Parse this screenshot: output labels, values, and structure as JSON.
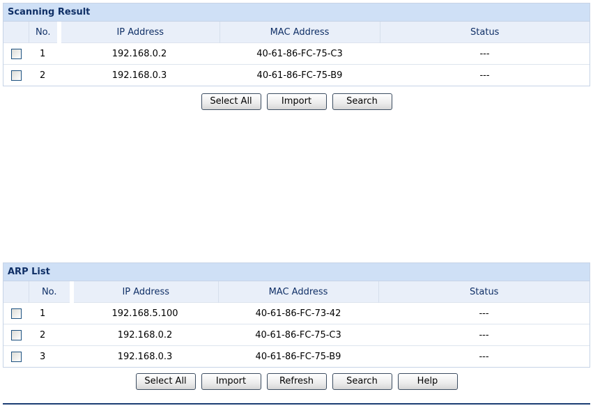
{
  "scanning_result": {
    "title": "Scanning Result",
    "columns": {
      "no": "No.",
      "ip": "IP Address",
      "mac": "MAC Address",
      "status": "Status"
    },
    "rows": [
      {
        "no": "1",
        "ip": "192.168.0.2",
        "mac": "40-61-86-FC-75-C3",
        "status": "---"
      },
      {
        "no": "2",
        "ip": "192.168.0.3",
        "mac": "40-61-86-FC-75-B9",
        "status": "---"
      }
    ],
    "buttons": {
      "select_all": "Select All",
      "import": "Import",
      "search": "Search"
    }
  },
  "arp_list": {
    "title": "ARP List",
    "columns": {
      "no": "No.",
      "ip": "IP Address",
      "mac": "MAC Address",
      "status": "Status"
    },
    "rows": [
      {
        "no": "1",
        "ip": "192.168.5.100",
        "mac": "40-61-86-FC-73-42",
        "status": "---"
      },
      {
        "no": "2",
        "ip": "192.168.0.2",
        "mac": "40-61-86-FC-75-C3",
        "status": "---"
      },
      {
        "no": "3",
        "ip": "192.168.0.3",
        "mac": "40-61-86-FC-75-B9",
        "status": "---"
      }
    ],
    "buttons": {
      "select_all": "Select All",
      "import": "Import",
      "refresh": "Refresh",
      "search": "Search",
      "help": "Help"
    }
  }
}
